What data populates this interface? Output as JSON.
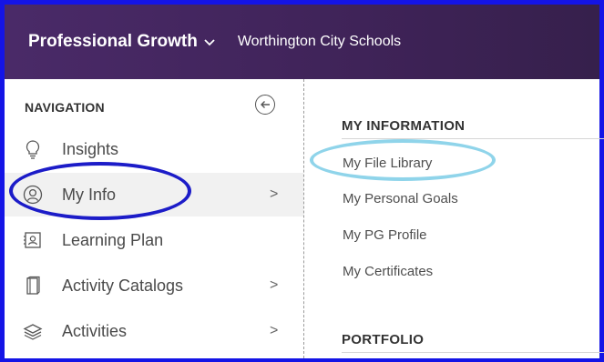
{
  "header": {
    "app_title": "Professional Growth",
    "district": "Worthington City Schools"
  },
  "sidebar": {
    "heading": "NAVIGATION",
    "items": [
      {
        "label": "Insights",
        "icon": "lightbulb-icon",
        "has_submenu": false
      },
      {
        "label": "My Info",
        "icon": "user-circle-icon",
        "has_submenu": true,
        "arrow": ">"
      },
      {
        "label": "Learning Plan",
        "icon": "id-card-icon",
        "has_submenu": false
      },
      {
        "label": "Activity Catalogs",
        "icon": "book-icon",
        "has_submenu": true,
        "arrow": ">"
      },
      {
        "label": "Activities",
        "icon": "layers-icon",
        "has_submenu": true,
        "arrow": ">"
      }
    ]
  },
  "submenu": {
    "sections": [
      {
        "title": "MY INFORMATION",
        "links": [
          "My File Library",
          "My Personal Goals",
          "My PG Profile",
          "My Certificates"
        ]
      },
      {
        "title": "PORTFOLIO",
        "links": []
      }
    ]
  },
  "annotations": {
    "myinfo_circle_color": "#1c1cc8",
    "library_circle_color": "#8fd4ea",
    "frame_color": "#1414e6"
  },
  "colors": {
    "header_bg": "#4a2a68",
    "active_bg": "#f1f1f1"
  }
}
